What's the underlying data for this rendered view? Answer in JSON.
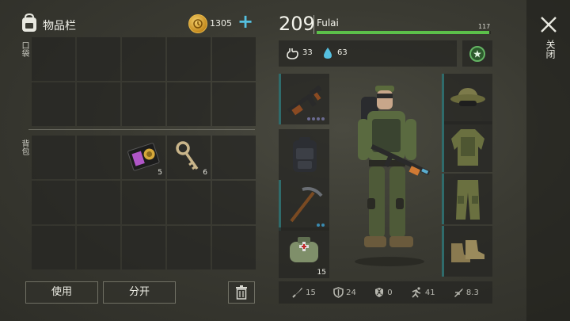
{
  "inventory": {
    "title": "物品栏",
    "coins": "1305",
    "add_label": "+",
    "pocket_label": "口袋",
    "backpack_label": "背包",
    "items": [
      {
        "name": "police-badge",
        "qty": "5"
      },
      {
        "name": "key",
        "qty": "6"
      }
    ],
    "use_label": "使用",
    "split_label": "分开"
  },
  "character": {
    "level": "209",
    "name": "Fulai",
    "xp_value": "117",
    "xp_fraction": 0.99,
    "food": "33",
    "water": "63"
  },
  "equipment": {
    "weapon_qty": "",
    "medkit_qty": "15"
  },
  "stats": {
    "attack": "15",
    "armor": "24",
    "radiation": "0",
    "speed": "41",
    "stealth": "8.3"
  },
  "close": {
    "label": "关闭"
  },
  "colors": {
    "accent_blue": "#55c0e0",
    "xp_green": "#5cc04a",
    "coin_gold": "#e9b949"
  }
}
